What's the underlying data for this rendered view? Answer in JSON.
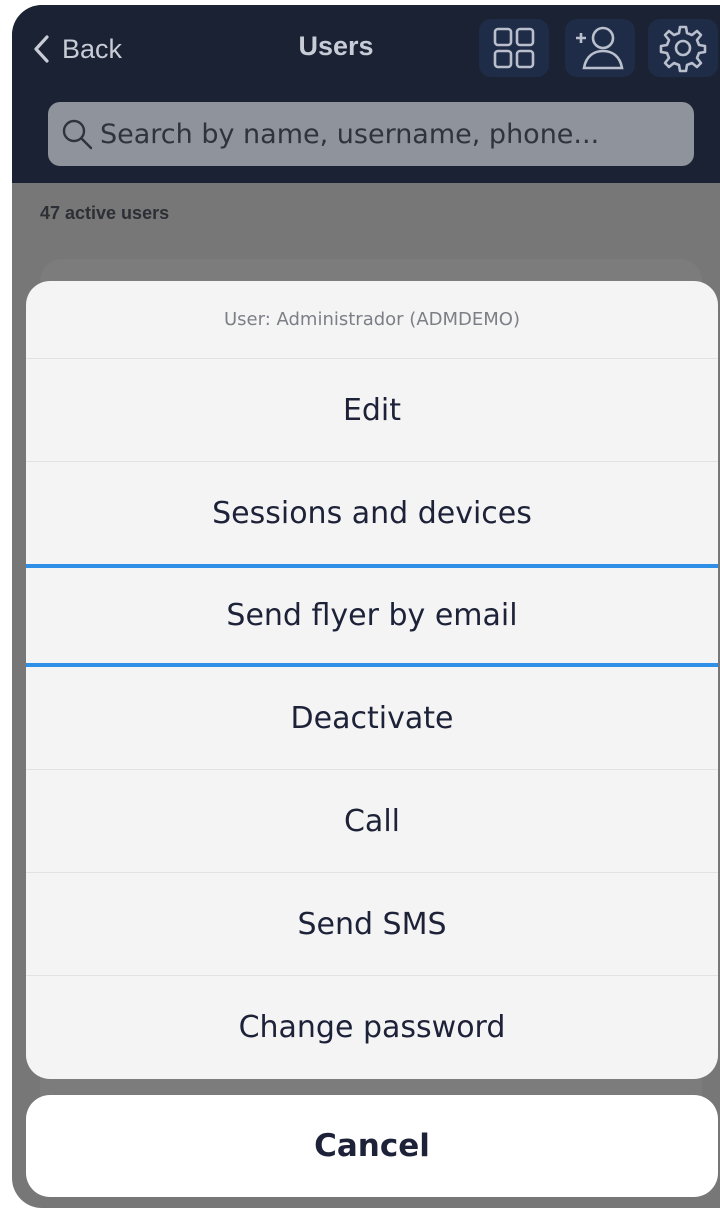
{
  "navbar": {
    "back_label": "Back",
    "title": "Users",
    "icons": [
      "grid-icon",
      "add-user-icon",
      "gear-icon"
    ]
  },
  "search": {
    "placeholder": "Search by name, username, phone..."
  },
  "list": {
    "count_label": "47 active users"
  },
  "action_sheet": {
    "header": "User: Administrador (ADMDEMO)",
    "options": [
      "Edit",
      "Sessions and devices",
      "Send flyer by email",
      "Deactivate",
      "Call",
      "Send SMS",
      "Change password"
    ],
    "highlighted_option": "Send flyer by email",
    "cancel_label": "Cancel"
  },
  "colors": {
    "navbar_bg": "#1a2233",
    "highlight_border": "#2f8ee6",
    "option_text": "#1d2238",
    "sheet_bg": "#f4f4f4"
  }
}
